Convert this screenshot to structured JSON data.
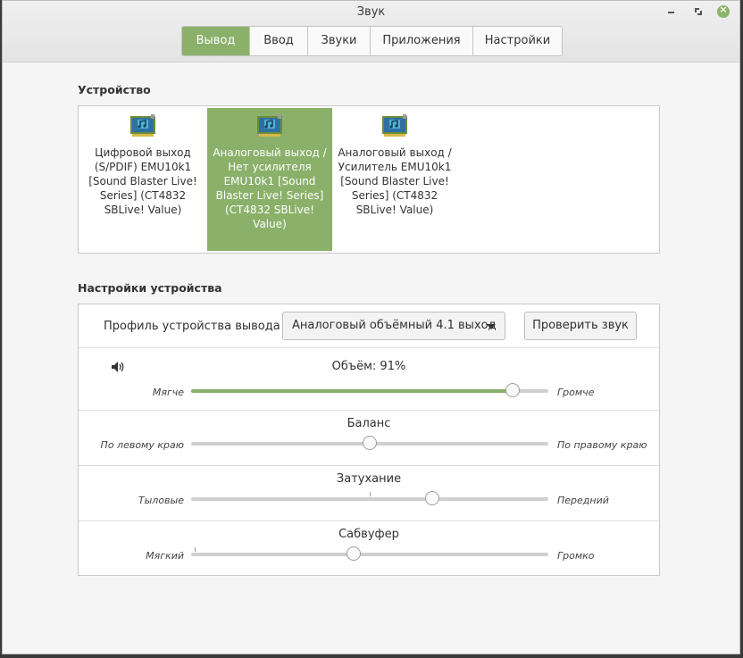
{
  "window": {
    "title": "Звук"
  },
  "tabs": [
    {
      "label": "Вывод",
      "active": true
    },
    {
      "label": "Ввод"
    },
    {
      "label": "Звуки"
    },
    {
      "label": "Приложения"
    },
    {
      "label": "Настройки"
    }
  ],
  "device_section": {
    "title": "Устройство",
    "devices": [
      {
        "label": "Цифровой выход (S/PDIF) EMU10k1 [Sound Blaster Live! Series] (CT4832 SBLive! Value)",
        "icon": "sound-card-icon",
        "selected": false
      },
      {
        "label": "Аналоговый выход / Нет усилителя EMU10k1 [Sound Blaster Live! Series] (CT4832 SBLive! Value)",
        "icon": "sound-card-icon",
        "selected": true
      },
      {
        "label": "Аналоговый выход / Усилитель EMU10k1 [Sound Blaster Live! Series] (CT4832 SBLive! Value)",
        "icon": "sound-card-icon",
        "selected": false
      }
    ]
  },
  "settings_section": {
    "title": "Настройки устройства",
    "profile_label": "Профиль устройства вывода",
    "profile_value": "Аналоговый объёмный 4.1 выход",
    "test_button": "Проверить звук"
  },
  "sliders": {
    "volume": {
      "title": "Объём: 91%",
      "left": "Мягче",
      "right": "Громче",
      "value": 0.9
    },
    "balance": {
      "title": "Баланс",
      "left": "По левому краю",
      "right": "По правому краю",
      "value": 0.5
    },
    "fade": {
      "title": "Затухание",
      "left": "Тыловые",
      "right": "Передний",
      "value": 0.675
    },
    "subwoofer": {
      "title": "Сабвуфер",
      "left": "Мягкий",
      "right": "Громко",
      "value": 0.455
    }
  },
  "colors": {
    "accent": "#8ab06a",
    "close_button": "#8cb56a"
  }
}
